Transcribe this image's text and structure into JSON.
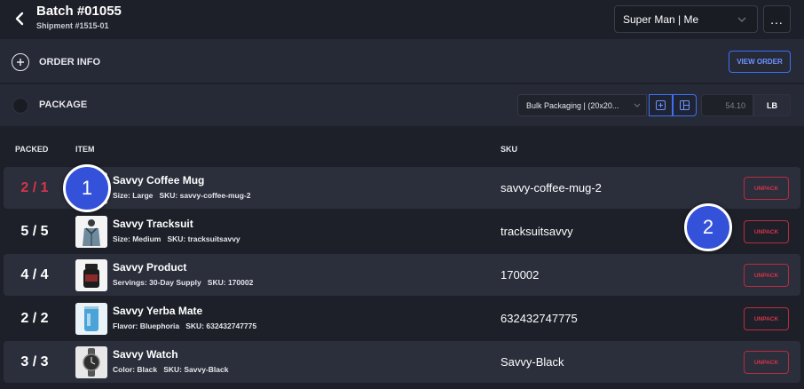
{
  "header": {
    "title": "Batch #01055",
    "subtitle": "Shipment #1515-01",
    "user_select": "Super Man | Me",
    "more_label": "..."
  },
  "order_info": {
    "label": "ORDER INFO",
    "view_order_label": "VIEW ORDER"
  },
  "package": {
    "label": "PACKAGE",
    "packaging_value": "Bulk Packaging | (20x20...",
    "weight_value": "54.10",
    "weight_unit": "LB"
  },
  "table": {
    "headers": {
      "packed": "PACKED",
      "item": "ITEM",
      "sku": "SKU"
    },
    "rows": [
      {
        "packed": "2 / 1",
        "name": "Savvy Coffee Mug",
        "attr_label": "Size:",
        "attr_value": "Large",
        "sku_label": "SKU:",
        "sku_inline": "savvy-coffee-mug-2",
        "sku": "savvy-coffee-mug-2",
        "unpack_label": "UNPACK",
        "thumb_icon": "coffee-mug-icon"
      },
      {
        "packed": "5 / 5",
        "name": "Savvy Tracksuit",
        "attr_label": "Size:",
        "attr_value": "Medium",
        "sku_label": "SKU:",
        "sku_inline": "tracksuitsavvy",
        "sku": "tracksuitsavvy",
        "unpack_label": "UNPACK",
        "thumb_icon": "tracksuit-icon"
      },
      {
        "packed": "4 / 4",
        "name": "Savvy Product",
        "attr_label": "Servings:",
        "attr_value": "30-Day Supply",
        "sku_label": "SKU:",
        "sku_inline": "170002",
        "sku": "170002",
        "unpack_label": "UNPACK",
        "thumb_icon": "supplement-jar-icon"
      },
      {
        "packed": "2 / 2",
        "name": "Savvy Yerba Mate",
        "attr_label": "Flavor:",
        "attr_value": "Bluephoria",
        "sku_label": "SKU:",
        "sku_inline": "632432747775",
        "sku": "632432747775",
        "unpack_label": "UNPACK",
        "thumb_icon": "can-icon"
      },
      {
        "packed": "3 / 3",
        "name": "Savvy Watch",
        "attr_label": "Color:",
        "attr_value": "Black",
        "sku_label": "SKU:",
        "sku_inline": "Savvy-Black",
        "sku": "Savvy-Black",
        "unpack_label": "UNPACK",
        "thumb_icon": "watch-icon"
      }
    ]
  },
  "markers": {
    "one": "1",
    "two": "2"
  },
  "colors": {
    "background": "#1e2029",
    "panel": "#262936",
    "row_alt": "#2b2e3b",
    "accent_blue": "#3f6ff5",
    "danger_red": "#d6344a"
  }
}
